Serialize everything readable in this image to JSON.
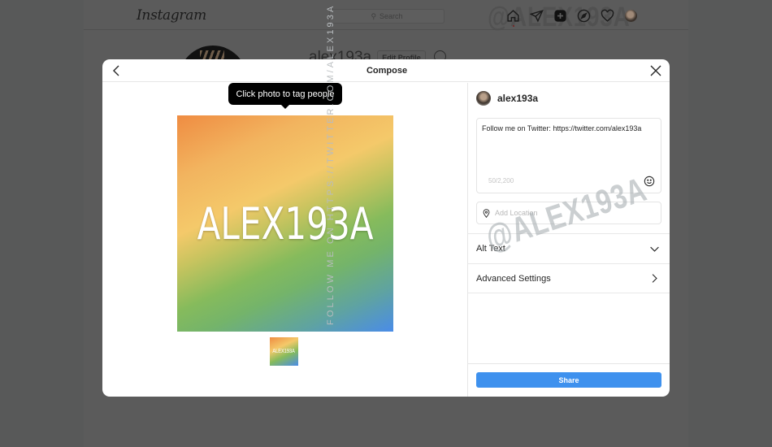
{
  "app": {
    "logo": "Instagram",
    "search_placeholder": "Search",
    "nav_icons": [
      "home-icon",
      "direct-message-icon",
      "new-post-icon",
      "explore-icon",
      "activity-heart-icon",
      "profile-avatar"
    ],
    "profile_name": "alex193a",
    "edit_profile_label": "Edit Profile"
  },
  "modal": {
    "title": "Compose",
    "back_icon": "chevron-left-icon",
    "close_icon": "close-icon",
    "tooltip": "Click photo to tag people",
    "photo_text": "ALEX193A",
    "thumbnail_text": "ALEX193A",
    "user": {
      "username": "alex193a"
    },
    "caption": {
      "value": "Follow me on Twitter: https://twitter.com/alex193a",
      "char_count": "50/2,200"
    },
    "location": {
      "placeholder": "Add Location"
    },
    "alt_text_label": "Alt Text",
    "advanced_settings_label": "Advanced Settings",
    "share_label": "Share"
  },
  "watermarks": {
    "top": "@ALEX193A",
    "diagonal": "@ALEX193A",
    "vertical": "FOLLOW ME ON HTTPS://TWITTER.COM/ALEX193A"
  },
  "colors": {
    "accent_blue": "#3e91ee",
    "overlay": "#585959"
  }
}
